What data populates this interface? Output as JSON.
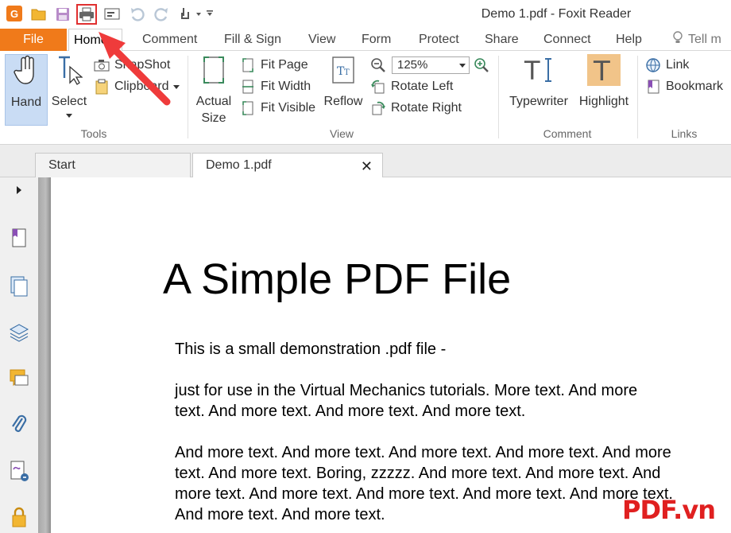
{
  "window": {
    "title": "Demo 1.pdf - Foxit Reader"
  },
  "quick_access": {
    "logo_letter": "G",
    "icons": [
      "open-folder-icon",
      "save-icon",
      "print-icon",
      "screen-icon",
      "undo-icon",
      "redo-icon",
      "touch-icon"
    ]
  },
  "menu_tabs": {
    "file": "File",
    "home": "Home",
    "comment": "Comment",
    "fill_sign": "Fill & Sign",
    "view": "View",
    "form": "Form",
    "protect": "Protect",
    "share": "Share",
    "connect": "Connect",
    "help": "Help",
    "tell_me": "Tell m"
  },
  "ribbon": {
    "tools": {
      "label": "Tools",
      "hand": "Hand",
      "select": "Select",
      "snapshot": "SnapShot",
      "clipboard": "Clipboard"
    },
    "view": {
      "label": "View",
      "actual_size_1": "Actual",
      "actual_size_2": "Size",
      "fit_page": "Fit Page",
      "fit_width": "Fit Width",
      "fit_visible": "Fit Visible",
      "reflow": "Reflow",
      "zoom": "125%",
      "rotate_left": "Rotate Left",
      "rotate_right": "Rotate Right"
    },
    "comment": {
      "label": "Comment",
      "typewriter": "Typewriter",
      "highlight": "Highlight"
    },
    "links": {
      "label": "Links",
      "link": "Link",
      "bookmark": "Bookmark"
    }
  },
  "doc_tabs": {
    "start": "Start",
    "demo": "Demo 1.pdf"
  },
  "document": {
    "title": "A Simple PDF File",
    "p1": "This is a small demonstration .pdf file -",
    "p2_l1": "just for use in the Virtual Mechanics tutorials. More text. And more",
    "p2_l2": "text. And more text. And more text. And more text.",
    "p3_l1": "And more text. And more text. And more text. And more text. And more",
    "p3_l2": "text. And more text. Boring, zzzzz. And more text. And more text. And",
    "p3_l3": "more text. And more text. And more text. And more text. And more text.",
    "p3_l4": "And more text. And more text."
  },
  "watermark": "PDF.vn",
  "colors": {
    "accent": "#f07a1a",
    "highlight_red": "#e03030"
  }
}
